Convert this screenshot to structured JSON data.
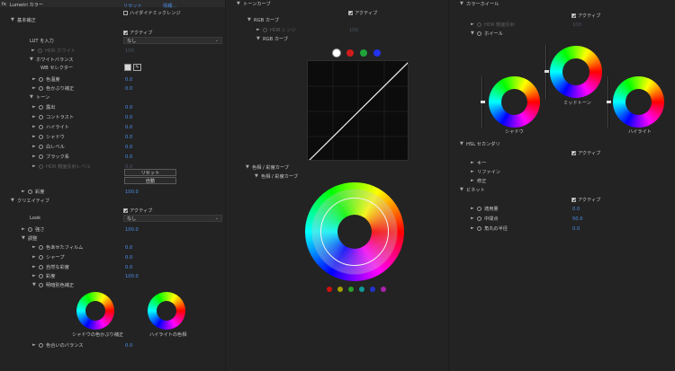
{
  "panel1": {
    "header": {
      "fx": "fx",
      "title": "Lumetri カラー",
      "reset": "リセット",
      "more": "情報..."
    },
    "hdr_checkbox": "ハイダイナミックレンジ",
    "basic": {
      "title": "基本補正",
      "active": "アクティブ",
      "lut_label": "LUT を入力",
      "lut_value": "なし",
      "hdr_white": "HDR ホワイト",
      "hdr_white_val": "100",
      "wb_title": "ホワイトバランス",
      "wb_selector": "WB セレクター",
      "rows": [
        {
          "label": "色温度",
          "value": "0.0"
        },
        {
          "label": "色かぶり補正",
          "value": "0.0"
        }
      ],
      "tone_title": "トーン",
      "tone_rows": [
        {
          "label": "露出",
          "value": "0.0"
        },
        {
          "label": "コントラスト",
          "value": "0.0"
        },
        {
          "label": "ハイライト",
          "value": "0.0"
        },
        {
          "label": "シャドウ",
          "value": "0.0"
        },
        {
          "label": "白レベル",
          "value": "0.0"
        },
        {
          "label": "ブラック系",
          "value": "0.0"
        },
        {
          "label": "HDR 鏡面反射レベル",
          "value": "0.0"
        }
      ],
      "reset_btn": "リセット",
      "auto_btn": "自動",
      "saturation_label": "彩度",
      "saturation_val": "100.0"
    },
    "creative": {
      "title": "クリエイティブ",
      "active": "アクティブ",
      "look_label": "Look",
      "look_value": "なし",
      "intensity_label": "強さ",
      "intensity_val": "100.0",
      "adjust_title": "調整",
      "rows": [
        {
          "label": "色あせたフィルム",
          "value": "0.0"
        },
        {
          "label": "シャープ",
          "value": "0.0"
        },
        {
          "label": "自然な彩度",
          "value": "0.0"
        },
        {
          "label": "彩度",
          "value": "100.0"
        }
      ],
      "split_tone": "明暗別色補正",
      "shadow_tint": "シャドウの色かぶり補正",
      "highlight_tint": "ハイライトの色相",
      "tint_balance": "色合いのバランス",
      "tint_balance_val": "0.0"
    }
  },
  "panel2": {
    "title": "トーンカーブ",
    "active": "アクティブ",
    "rgb_curve": "RGB カーブ",
    "hdr_range": "HDR レンジ",
    "hdr_range_val": "100",
    "rgb_curve_sub": "RGB カーブ",
    "channel_colors": [
      "#ffffff",
      "#d11b1b",
      "#1fa53a",
      "#2233ee"
    ],
    "hue_sat_title": "色相 / 彩度カーブ",
    "hue_sat_sub": "色相 / 彩度カーブ",
    "swatch_colors": [
      "#cc1111",
      "#a8a000",
      "#2aa12a",
      "#119999",
      "#2233cc",
      "#aa22aa"
    ]
  },
  "panel3": {
    "title": "カラーホイール",
    "active": "アクティブ",
    "hdr_range": "HDR 鏡面反射",
    "hdr_range_val": "100",
    "wheel_title": "ホイール",
    "shadow": "シャドウ",
    "midtone": "ミッドトーン",
    "highlight": "ハイライト",
    "hsl_title": "HSL セカンダリ",
    "hsl_active": "アクティブ",
    "hsl_rows": [
      "キー",
      "リファイン",
      "修正"
    ],
    "vignette_title": "ビネット",
    "vignette_active": "アクティブ",
    "vignette_rows": [
      {
        "label": "適用量",
        "value": "0.0"
      },
      {
        "label": "中間点",
        "value": "50.0"
      },
      {
        "label": "角丸の半径",
        "value": "0.0"
      }
    ]
  }
}
